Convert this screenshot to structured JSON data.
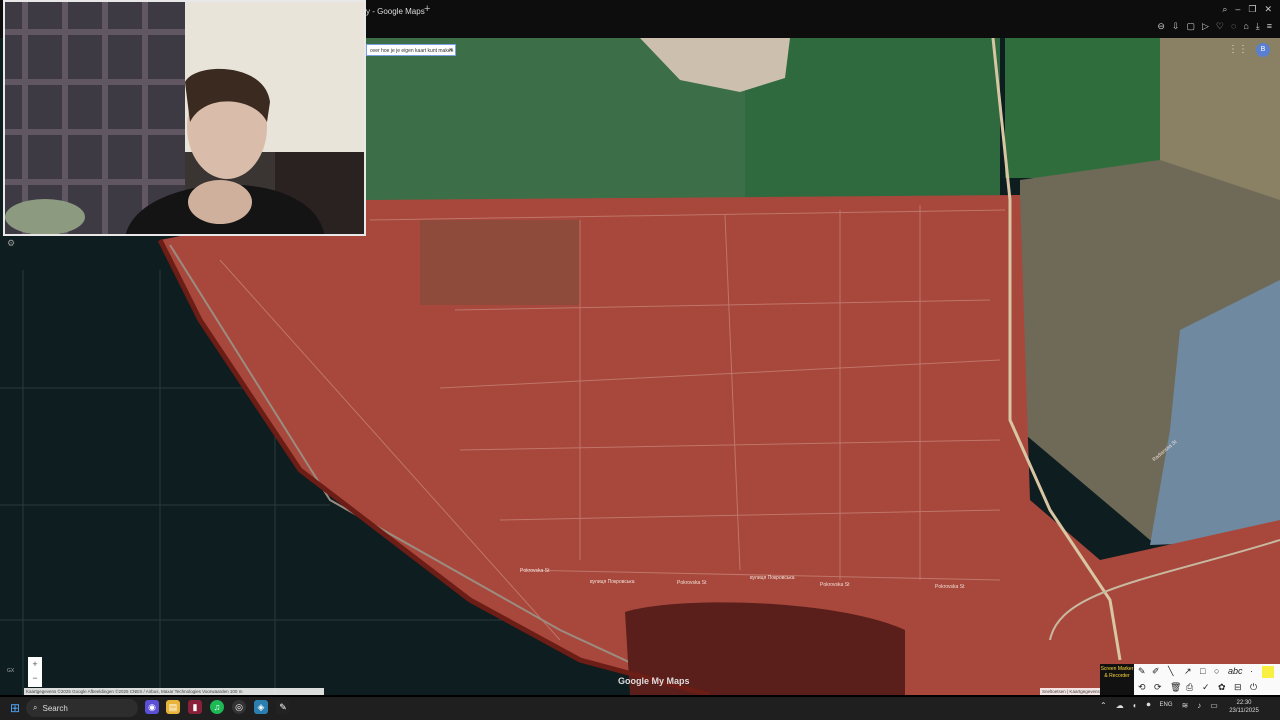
{
  "browser": {
    "tab_title": "y - Google Maps",
    "new_tab_icon": "plus-icon",
    "window_controls": [
      "search-icon",
      "minimize-icon",
      "restore-icon",
      "close-icon"
    ],
    "toolbar_icons": [
      "zoom-out-icon",
      "pin-icon",
      "window-icon",
      "play-icon",
      "heart-icon",
      "chat-icon",
      "camera-icon",
      "download-icon",
      "menu-icon"
    ]
  },
  "map": {
    "notice_text": "over hoe je je eigen kaart kunt maken",
    "notice_close": "×",
    "labels": {
      "pokrovska_1": "Pokrovska St",
      "pokrovska_2": "Pokrovska St",
      "pokrovska_3": "вулиця Покровська",
      "pokrovska_4": "Pokrovska St",
      "pokrovska_5": "вулиця Покровська",
      "pokrovska_6": "Pokrovska St",
      "radianska": "Radianska St"
    },
    "zoom_in": "+",
    "zoom_out": "−",
    "attribution": "Kaartgegevens ©2025 Google Afbeeldingen ©2025 CNES / Airbus, Maxar Technologies   Voorwaarden   100 m",
    "attribution_right": "Sneltoetsen | Kaartgegevens",
    "google_mymaps": "Google My Maps",
    "avatar_letter": "B",
    "sidebar_tag": "GX",
    "colors": {
      "occupied_overlay": "#b5453d",
      "field_green": "#3f7a4d",
      "water": "#7a2a23"
    }
  },
  "marker_tool": {
    "logo_text": "Screen Marker & Recorder",
    "tools_row1": [
      "✎",
      "✐",
      "╲",
      "↗",
      "□",
      "○",
      "abc",
      "·"
    ],
    "tools_row2": [
      "⟲",
      "⟳",
      "🗑",
      "⎙",
      "✓",
      "✿",
      "⊟",
      "⏻"
    ]
  },
  "taskbar": {
    "search_placeholder": "Search",
    "lang": "ENG",
    "time": "22:30",
    "date": "23/11/2025"
  }
}
